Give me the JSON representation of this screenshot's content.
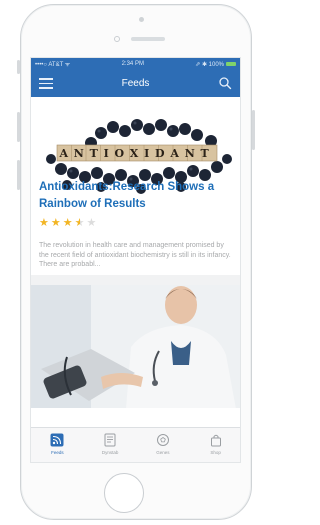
{
  "status": {
    "carrier": "••••○ AT&T ᯤ",
    "time": "2:34 PM",
    "battery": "⇗ ✱ 100%"
  },
  "header": {
    "title": "Feeds"
  },
  "article": {
    "image_text": "ANTIOXIDANT",
    "title": "Antioxidants:Research Shows a Rainbow of Results",
    "rating": 3.5,
    "rating_max": 5,
    "excerpt": "The revolution in health care and management promised by the recent field of antioxidant biochemistry is still in its infancy. There are probabl..."
  },
  "tabs": [
    {
      "label": "Feeds",
      "icon": "rss-icon",
      "active": true
    },
    {
      "label": "Dynstab",
      "icon": "document-icon",
      "active": false
    },
    {
      "label": "Genes",
      "icon": "ball-icon",
      "active": false
    },
    {
      "label": "Shop",
      "icon": "bag-icon",
      "active": false
    }
  ],
  "colors": {
    "accent": "#2d6db5",
    "star": "#f2b524",
    "title": "#1f6fb8"
  }
}
